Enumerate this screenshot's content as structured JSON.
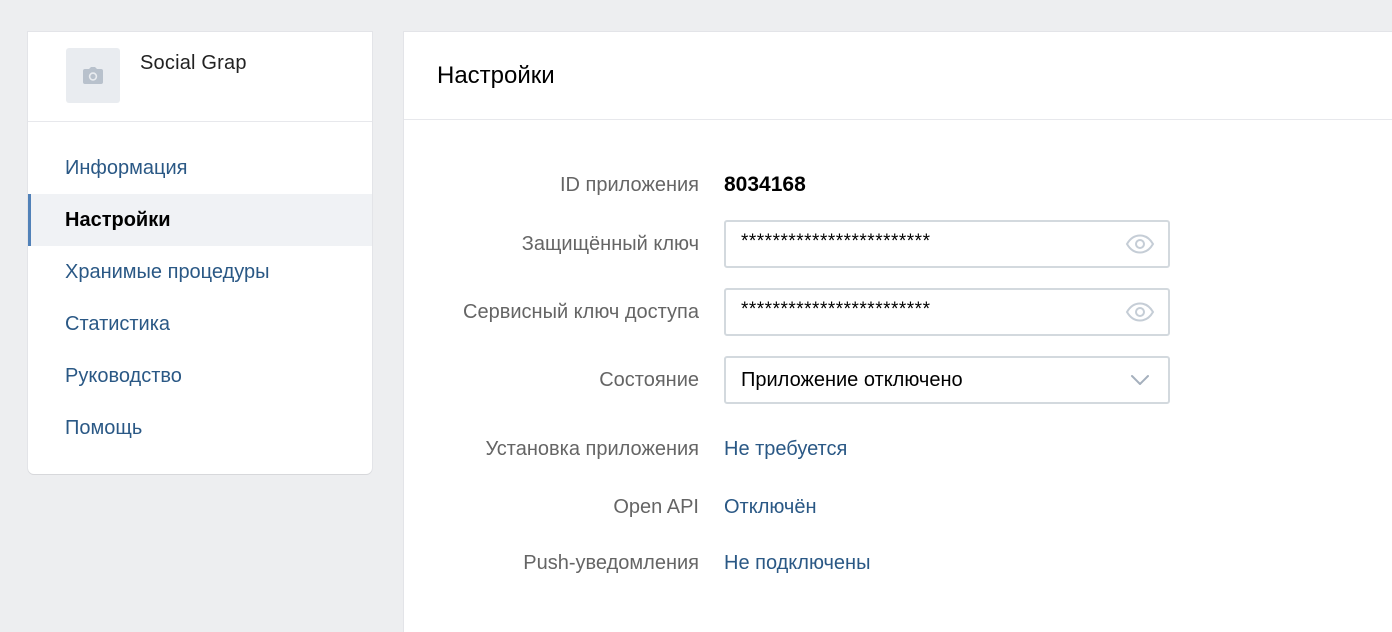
{
  "app": {
    "name": "Social Grap"
  },
  "sidebar": {
    "items": [
      {
        "label": "Информация",
        "active": false
      },
      {
        "label": "Настройки",
        "active": true
      },
      {
        "label": "Хранимые процедуры",
        "active": false
      },
      {
        "label": "Статистика",
        "active": false
      },
      {
        "label": "Руководство",
        "active": false
      },
      {
        "label": "Помощь",
        "active": false
      }
    ]
  },
  "main": {
    "title": "Настройки",
    "fields": {
      "app_id": {
        "label": "ID приложения",
        "value": "8034168"
      },
      "secure_key": {
        "label": "Защищённый ключ",
        "value": "************************"
      },
      "service_key": {
        "label": "Сервисный ключ доступа",
        "value": "************************"
      },
      "state": {
        "label": "Состояние",
        "value": "Приложение отключено"
      },
      "install": {
        "label": "Установка приложения",
        "value": "Не требуется"
      },
      "open_api": {
        "label": "Open API",
        "value": "Отключён"
      },
      "push": {
        "label": "Push-уведомления",
        "value": "Не подключены"
      }
    }
  },
  "icons": {
    "app_thumb": "camera-icon",
    "reveal": "eye-icon",
    "dropdown": "chevron-down-icon"
  },
  "colors": {
    "link": "#2a5885",
    "active_marker": "#5181b8",
    "page_bg": "#edeef0"
  }
}
